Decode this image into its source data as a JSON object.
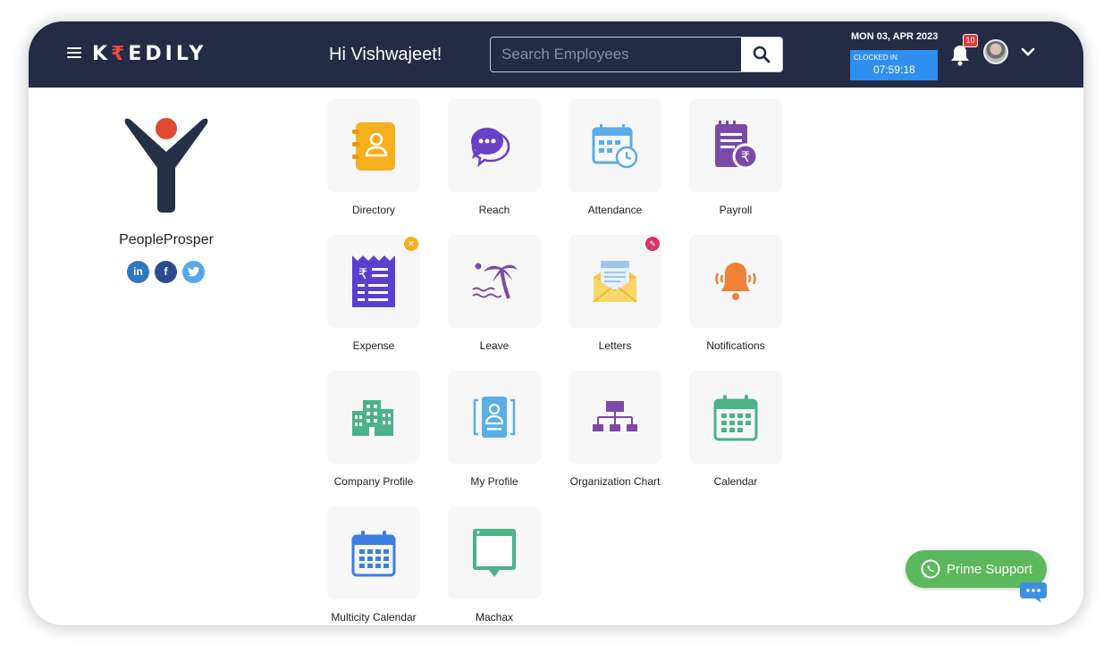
{
  "header": {
    "logo_text": "K",
    "logo_rupee": "₹",
    "logo_rest": "EDILY",
    "greeting": "Hi Vishwajeet!",
    "search_placeholder": "Search Employees",
    "date": "MON 03, APR 2023",
    "clock_label": "CLOCKED IN",
    "clock_time": "07:59:18",
    "notification_count": "10"
  },
  "company": {
    "name": "PeopleProsper",
    "social": [
      "in",
      "f",
      "t"
    ]
  },
  "modules": [
    {
      "label": "Directory",
      "icon": "directory-icon"
    },
    {
      "label": "Reach",
      "icon": "chat-bubbles-icon"
    },
    {
      "label": "Attendance",
      "icon": "attendance-calendar-icon"
    },
    {
      "label": "Payroll",
      "icon": "payroll-invoice-icon"
    },
    {
      "label": "Expense",
      "icon": "expense-receipt-icon"
    },
    {
      "label": "Leave",
      "icon": "beach-palm-icon"
    },
    {
      "label": "Letters",
      "icon": "envelope-icon"
    },
    {
      "label": "Notifications",
      "icon": "bell-ringing-icon"
    },
    {
      "label": "Company Profile",
      "icon": "building-icon"
    },
    {
      "label": "My Profile",
      "icon": "id-card-icon"
    },
    {
      "label": "Organization Chart",
      "icon": "org-chart-icon"
    },
    {
      "label": "Calendar",
      "icon": "calendar-icon"
    },
    {
      "label": "Multicity Calendar",
      "icon": "multicity-calendar-icon"
    },
    {
      "label": "Machax",
      "icon": "machax-screen-icon"
    }
  ],
  "support": {
    "label": "Prime Support"
  },
  "colors": {
    "header_bg": "#232b45",
    "clock_bg": "#2e8ff0",
    "support_bg": "#5cb85c",
    "badge": "#e53935"
  }
}
